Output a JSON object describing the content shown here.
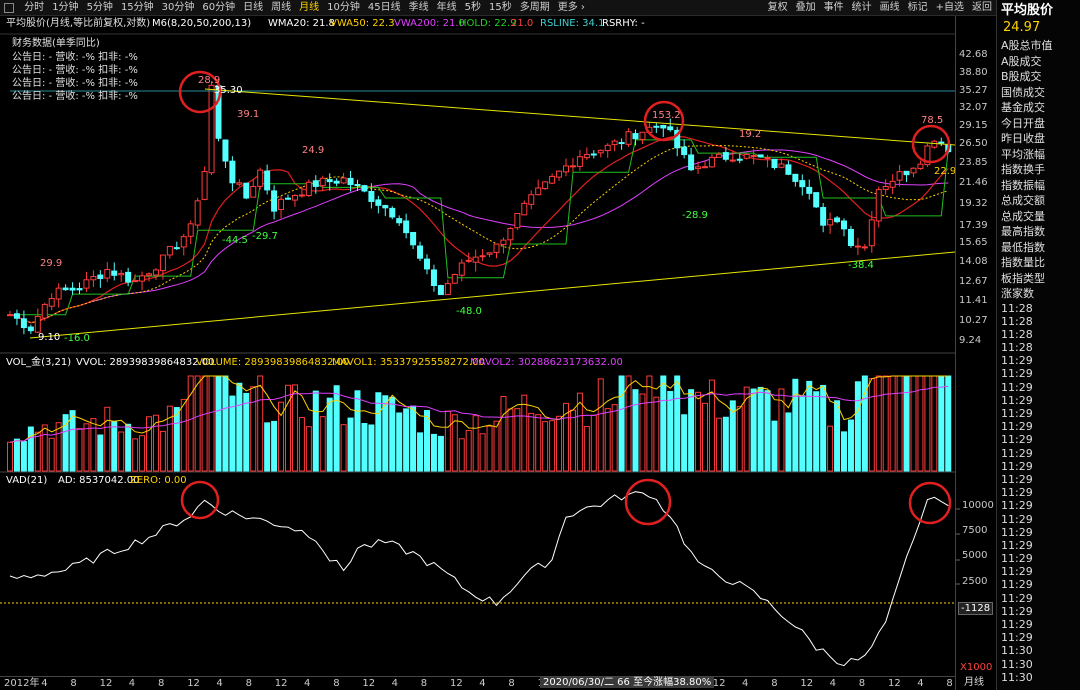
{
  "toolbar": {
    "items": [
      "分时",
      "1分钟",
      "5分钟",
      "15分钟",
      "30分钟",
      "60分钟",
      "日线",
      "周线",
      "月线",
      "10分钟",
      "45日线",
      "季线",
      "年线",
      "5秒",
      "15秒",
      "多周期",
      "更多 ›"
    ],
    "active": "月线",
    "right": [
      "复权",
      "叠加",
      "事件",
      "统计",
      "画线",
      "标记",
      "+自选",
      "返回"
    ]
  },
  "side": {
    "title": "平均股价",
    "price": "24.97",
    "items": [
      "A股总市值",
      "A股成交",
      "B股成交",
      "国债成交",
      "基金成交",
      "今日开盘",
      "昨日收盘",
      "平均涨幅",
      "指数换手",
      "指数振幅",
      "总成交额",
      "总成交量",
      "最高指数",
      "最低指数",
      "指数量比",
      "板指类型",
      "涨家数"
    ],
    "times": [
      "11:28",
      "11:28",
      "11:28",
      "11:28",
      "11:29",
      "11:29",
      "11:29",
      "11:29",
      "11:29",
      "11:29",
      "11:29",
      "11:29",
      "11:29",
      "11:29",
      "11:29",
      "11:29",
      "11:29",
      "11:29",
      "11:29",
      "11:29",
      "11:29",
      "11:29",
      "11:29",
      "11:29",
      "11:29",
      "11:29",
      "11:30",
      "11:30",
      "11:30"
    ]
  },
  "main": {
    "header": "平均股价(月线,等比前复权,对数)",
    "m6": "M6(8,20,50,200,13)",
    "wma20": "WMA20: 21.8",
    "vwa50": "VWA50: 22.3",
    "vwa200": "VWA200: 21.0",
    "hold": "HOLD: 22.9",
    "hold2": "21.0",
    "rsline": "RSLINE: 34.1",
    "rsrhy": "RSRHY: -",
    "fin_title": "财务数据(单季同比)",
    "fin_rows": [
      "公告日: -    营收: -%    扣非: -%",
      "公告日: -    营收: -%    扣非: -%",
      "公告日: -    营收: -%    扣非: -%",
      "公告日: -    营收: -%    扣非: -%"
    ],
    "yticks": [
      "42.68",
      "38.80",
      "35.27",
      "32.07",
      "29.15",
      "26.50",
      "23.85",
      "21.46",
      "19.32",
      "17.39",
      "15.65",
      "14.08",
      "12.67",
      "11.41",
      "10.27",
      "9.24"
    ],
    "annotations": {
      "a_low": "9.10",
      "a_up": "35.30",
      "a1": "29.9",
      "a2": "-16.0",
      "a3": "39.1",
      "a4": "-44.5",
      "a5": "-29.7",
      "a6": "24.9",
      "a7": "-48.0",
      "a8": "153.2",
      "a9": "19.2",
      "a10": "-28.9",
      "a11": "-38.4",
      "a12": "78.5",
      "a13": "22.9",
      "a14": "28.9"
    }
  },
  "vol": {
    "label": "VOL_金(3,21)",
    "vvol": "VVOL: 28939839864832.00",
    "volume": "VOLUME: 28939839864832.00",
    "mavol1": "MAVOL1: 35337925558272.00",
    "mavol2": "MAVOL2: 30288623173632.00"
  },
  "vad": {
    "label": "VAD(21)",
    "ad": "AD: 8537042.00",
    "zero": "ZERO: 0.00",
    "yticks": [
      "10000",
      "7500",
      "5000",
      "2500"
    ],
    "marker": "-1128",
    "unit": "X1000"
  },
  "xaxis": {
    "labels": [
      "2012年",
      "4",
      "8",
      "12",
      "4",
      "8",
      "12",
      "4",
      "8",
      "12",
      "4",
      "8",
      "12",
      "4",
      "8",
      "12",
      "4",
      "8",
      "12",
      "4",
      "8",
      "12",
      "4",
      "8",
      "12",
      "4",
      "8",
      "12",
      "4",
      "8",
      "12",
      "4",
      "8"
    ],
    "tooltip": "2020/06/30/二 66 至今涨幅38.80%",
    "period": "月线"
  },
  "colors": {
    "up": "#ff3b3b",
    "down": "#54ffff",
    "accent": "#ffd200",
    "ma_purple": "#e040ff",
    "hold": "#20c020",
    "red_ma": "#e02020",
    "circle": "#e02020"
  }
}
